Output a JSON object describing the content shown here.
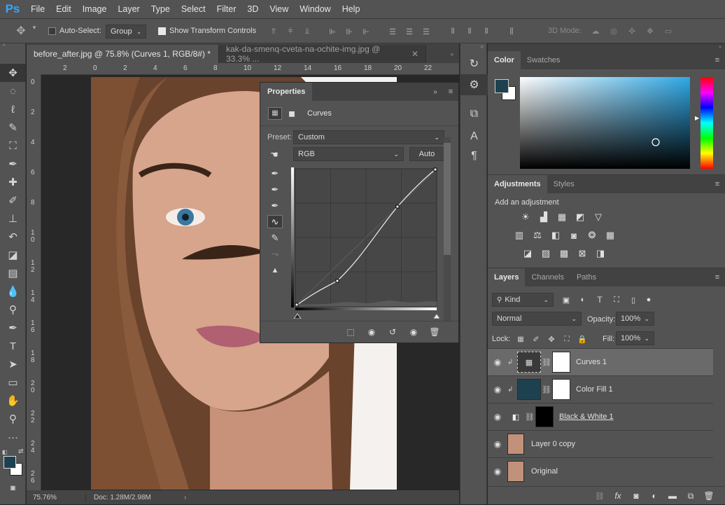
{
  "app": {
    "logo": "Ps"
  },
  "menu": [
    "File",
    "Edit",
    "Image",
    "Layer",
    "Type",
    "Select",
    "Filter",
    "3D",
    "View",
    "Window",
    "Help"
  ],
  "options": {
    "auto_select_label": "Auto-Select:",
    "auto_select_checked": false,
    "auto_select_value": "Group",
    "transform_label": "Show Transform Controls",
    "transform_checked": true,
    "mode_3d": "3D Mode:"
  },
  "tabs": [
    {
      "label": "before_after.jpg @ 75.8% (Curves 1, RGB/8#) *",
      "active": true
    },
    {
      "label": "kak-da-smenq-cveta-na-ochite-img.jpg @ 33.3% ...",
      "active": false
    }
  ],
  "ruler": {
    "h": [
      "2",
      "0",
      "2",
      "4",
      "6",
      "8",
      "10",
      "12",
      "14",
      "16",
      "18",
      "20",
      "22"
    ],
    "v": [
      "0",
      "2",
      "4",
      "6",
      "8",
      "1\n0",
      "1\n2",
      "1\n4",
      "1\n6",
      "1\n8",
      "2\n0",
      "2\n2",
      "2\n4",
      "2\n6"
    ]
  },
  "status": {
    "zoom": "75.76%",
    "doc": "Doc: 1.28M/2.98M"
  },
  "properties": {
    "tab": "Properties",
    "title": "Curves",
    "preset_label": "Preset:",
    "preset_value": "Custom",
    "channel": "RGB",
    "auto_label": "Auto"
  },
  "color_panel": {
    "tabs": [
      "Color",
      "Swatches"
    ],
    "foreground": "#1e4150",
    "background": "#ffffff",
    "hue": "#2ea8e6"
  },
  "adjustments": {
    "tabs": [
      "Adjustments",
      "Styles"
    ],
    "title": "Add an adjustment"
  },
  "layers_panel": {
    "tabs": [
      "Layers",
      "Channels",
      "Paths"
    ],
    "filter": "Kind",
    "blend_mode": "Normal",
    "opacity_label": "Opacity:",
    "opacity": "100%",
    "lock_label": "Lock:",
    "fill_label": "Fill:",
    "fill": "100%",
    "layers": [
      {
        "name": "Curves 1",
        "selected": true,
        "type": "curves"
      },
      {
        "name": "Color Fill 1",
        "selected": false,
        "type": "colorfill"
      },
      {
        "name": "Black & White 1",
        "selected": false,
        "type": "bw"
      },
      {
        "name": "Layer 0 copy",
        "selected": false,
        "type": "photo"
      },
      {
        "name": "Original",
        "selected": false,
        "type": "photo"
      }
    ]
  }
}
